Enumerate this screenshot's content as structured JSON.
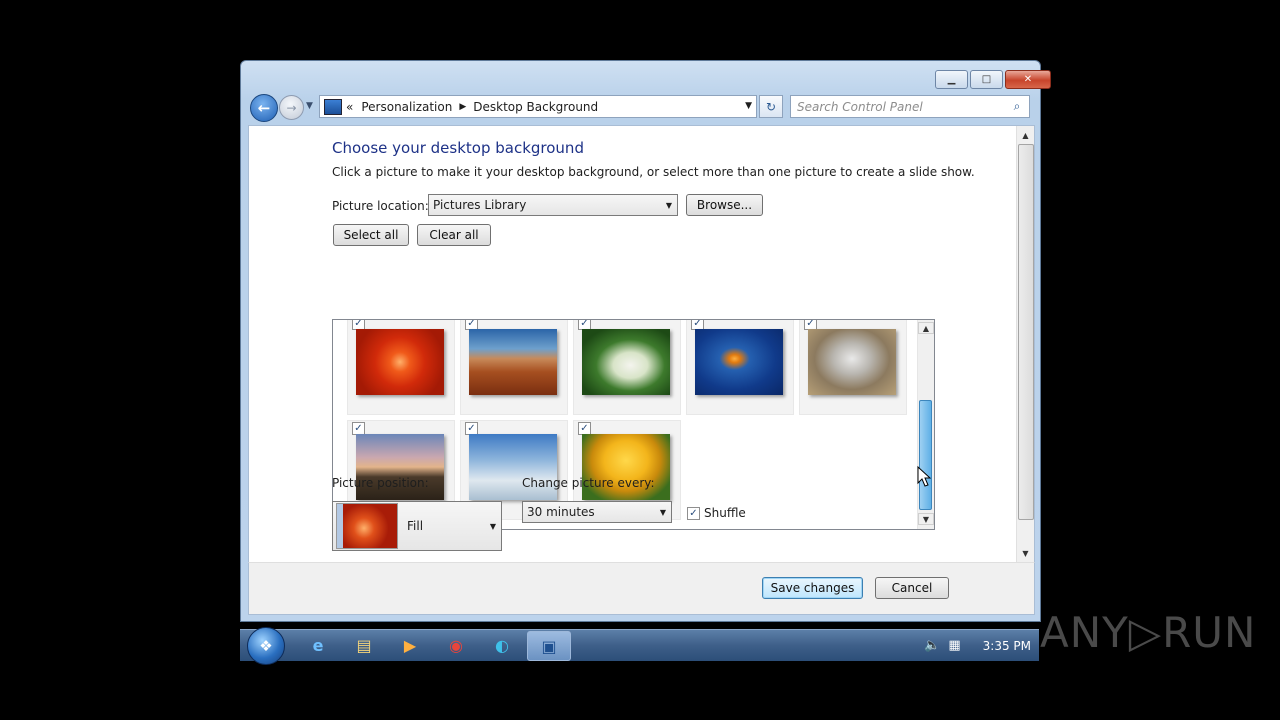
{
  "window": {
    "minimize_label": "▁",
    "maximize_label": "□",
    "close_label": "✕"
  },
  "nav": {
    "back_icon": "←",
    "forward_icon": "→",
    "breadcrumb_overflow": "«",
    "breadcrumb": [
      "Personalization",
      "Desktop Background"
    ],
    "refresh_icon": "↻",
    "search_placeholder": "Search Control Panel",
    "search_icon": "⌕"
  },
  "main": {
    "title": "Choose your desktop background",
    "description": "Click a picture to make it your desktop background, or select more than one picture to create a slide show.",
    "picture_location_label": "Picture location:",
    "picture_location_value": "Pictures Library",
    "browse_label": "Browse...",
    "select_all_label": "Select all",
    "clear_all_label": "Clear all",
    "pictures": [
      {
        "name": "Chrysanthemum",
        "checked": true,
        "theme": "t-chrys"
      },
      {
        "name": "Desert",
        "checked": true,
        "theme": "t-desert"
      },
      {
        "name": "Hydrangeas",
        "checked": true,
        "theme": "t-hydr"
      },
      {
        "name": "Jellyfish",
        "checked": true,
        "theme": "t-jelly"
      },
      {
        "name": "Koala",
        "checked": true,
        "theme": "t-koala"
      },
      {
        "name": "Lighthouse",
        "checked": true,
        "theme": "t-light"
      },
      {
        "name": "Penguins",
        "checked": true,
        "theme": "t-peng"
      },
      {
        "name": "Tulips",
        "checked": true,
        "theme": "t-tulip"
      }
    ],
    "picture_position_label": "Picture position:",
    "picture_position_value": "Fill",
    "change_every_label": "Change picture every:",
    "change_every_value": "30 minutes",
    "shuffle_label": "Shuffle",
    "shuffle_checked": true
  },
  "footer": {
    "save_label": "Save changes",
    "cancel_label": "Cancel"
  },
  "taskbar": {
    "start_icon": "❖",
    "apps": [
      {
        "name": "internet-explorer",
        "glyph": "e"
      },
      {
        "name": "file-explorer",
        "glyph": "▤"
      },
      {
        "name": "media-player",
        "glyph": "▶"
      },
      {
        "name": "chrome",
        "glyph": "◉"
      },
      {
        "name": "edge",
        "glyph": "◐"
      },
      {
        "name": "control-panel",
        "glyph": "▣"
      }
    ],
    "clock": "3:35 PM"
  },
  "watermark": "ANY▷RUN",
  "colors": {
    "title_blue": "#1e3287",
    "accent_scroll": "#5fb0e6"
  }
}
